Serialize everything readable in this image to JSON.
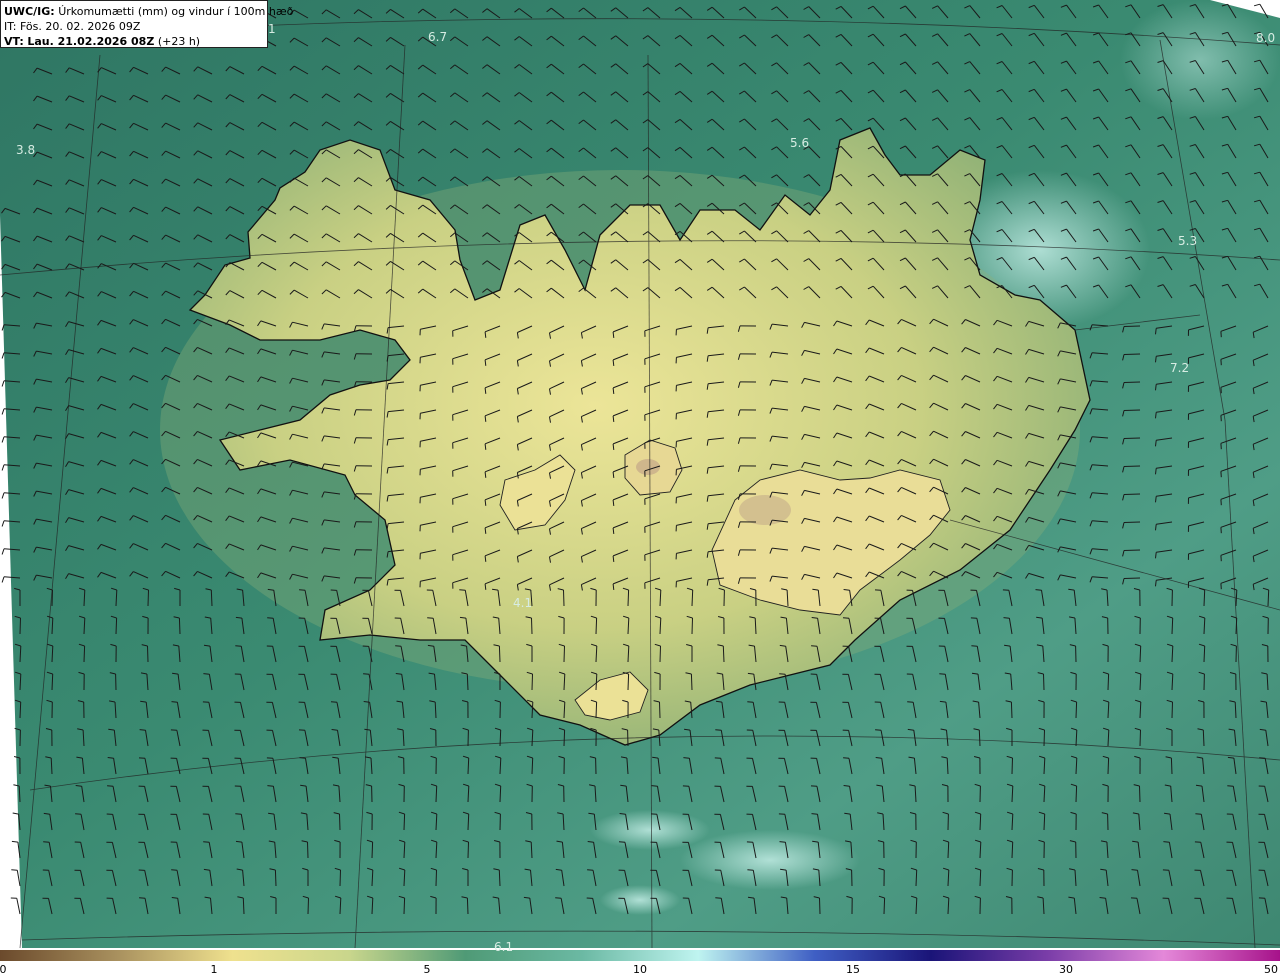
{
  "header": {
    "model": "UWC/IG:",
    "product": "Úrkomumætti (mm) og vindur í 100m hæð",
    "it_label": "IT:",
    "it_value": "Fös. 20. 02. 2026 09Z",
    "vt_label": "VT:",
    "vt_value": "Lau. 21.02.2026 08Z",
    "lead": "(+23 h)"
  },
  "value_labels": [
    "1",
    "6.7",
    "8.0",
    "3.8",
    "5.6",
    "5.3",
    "7.2",
    "4.1",
    "6.1"
  ],
  "colorbar": {
    "ticks": [
      "0",
      "1",
      "5",
      "10",
      "15",
      "30",
      "50"
    ],
    "colors": [
      "#6b4a2c",
      "#a8905e",
      "#efe18e",
      "#c9d68c",
      "#4f9a76",
      "#6bb9a3",
      "#bff4f0",
      "#3f5fc4",
      "#1a1478",
      "#7a3da8",
      "#e488d9",
      "#a6128a"
    ]
  },
  "map": {
    "sea_color": "#3f8a73",
    "land_color": "#d6d889",
    "coast_color": "#111111",
    "barb_color": "#1a1a1a"
  }
}
